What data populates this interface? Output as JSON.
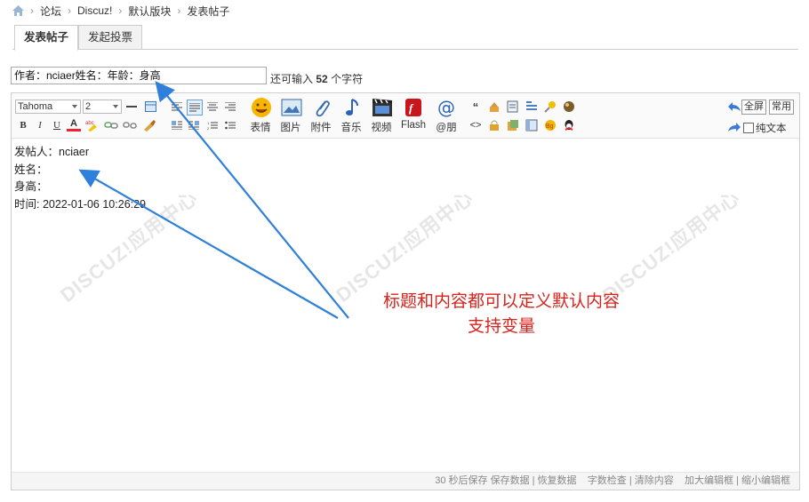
{
  "breadcrumb": {
    "items": [
      "论坛",
      "Discuz!",
      "默认版块",
      "发表帖子"
    ]
  },
  "tabs": [
    "发表帖子",
    "发起投票"
  ],
  "subject": {
    "value": "作者：nciaer姓名：年龄：身高"
  },
  "remain": {
    "prefix": "还可输入",
    "count": "52",
    "suffix": "个字符"
  },
  "toolbar": {
    "font": "Tahoma",
    "size": "2",
    "big_buttons": [
      "表情",
      "图片",
      "附件",
      "音乐",
      "视频",
      "Flash",
      "@朋"
    ],
    "fullscreen": "全屏",
    "common": "常用",
    "plaintext": "纯文本"
  },
  "content": {
    "lines": [
      "发帖人：nciaer",
      "姓名：",
      "身高：",
      "时间: 2022-01-06 10:26:29"
    ]
  },
  "status": [
    "30 秒后保存",
    "保存数据",
    "恢复数据",
    "字数检查",
    "清除内容",
    "加大编辑框",
    "缩小编辑框"
  ],
  "annotation": {
    "line1": "标题和内容都可以定义默认内容",
    "line2": "支持变量"
  },
  "watermark": "DISCUZ!应用中心",
  "colors": {
    "annotation": "#d8231c",
    "arrow": "#2f7fdc"
  }
}
